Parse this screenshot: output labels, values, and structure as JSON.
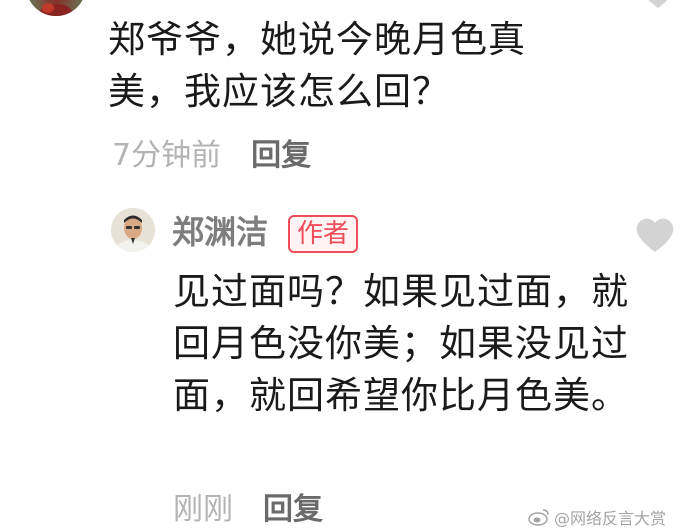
{
  "comment": {
    "text": "郑爷爷，她说今晚月色真美，我应该怎么回？",
    "time": "7分钟前",
    "reply_label": "回复"
  },
  "author_reply": {
    "name": "郑渊洁",
    "badge": "作者",
    "text": "见过面吗？如果见过面，就回月色没你美；如果没见过面，就回希望你比月色美。",
    "time": "刚刚",
    "reply_label": "回复"
  },
  "watermark": {
    "text": "@网络反言大赏"
  },
  "colors": {
    "badge_red": "#ee4d59",
    "heart_gray": "#d3d3d3",
    "meta_gray": "#b3b3b3"
  },
  "icons": {
    "like": "heart-icon",
    "weibo": "weibo-logo-icon"
  }
}
